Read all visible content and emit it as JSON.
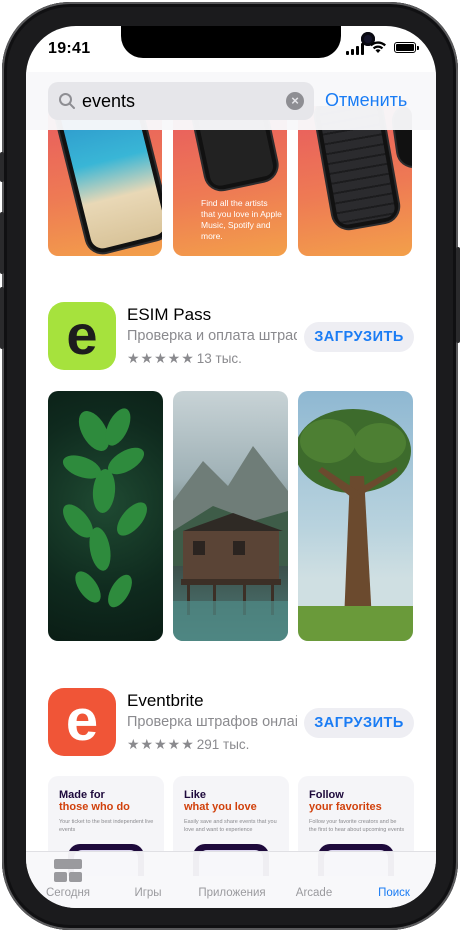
{
  "status": {
    "time": "19:41"
  },
  "search": {
    "query": "events",
    "cancel_label": "Отменить"
  },
  "top_screens": [
    {
      "caption": ""
    },
    {
      "caption": "Find all the artists that you love in Apple Music, Spotify and more."
    },
    {
      "caption": ""
    }
  ],
  "apps": [
    {
      "name": "ESIM Pass",
      "subtitle": "Проверка и оплата штрафов",
      "stars": "★★★★★",
      "rating_count": "13 тыс.",
      "get_label": "ЗАГРУЗИТЬ",
      "icon_letter": "e",
      "icon_color": "#a6e23d"
    },
    {
      "name": "Eventbrite",
      "subtitle": "Проверка штрафов онлайн",
      "stars": "★★★★★",
      "rating_count": "291 тыс.",
      "get_label": "ЗАГРУЗИТЬ",
      "icon_letter": "e",
      "icon_color": "#f05537"
    }
  ],
  "eventbrite_cards": [
    {
      "title": "Made for",
      "highlight": "those who do",
      "text": "Your ticket to the best independent live events"
    },
    {
      "title": "Like",
      "highlight": "what you love",
      "text": "Easily save and share events that you love and want to experience"
    },
    {
      "title": "Follow",
      "highlight": "your favorites",
      "text": "Follow your favorite creators and be the first to hear about upcoming events"
    }
  ],
  "tabbar": {
    "items": [
      {
        "label": "Сегодня",
        "icon": "today-icon",
        "active": false
      },
      {
        "label": "Игры",
        "icon": "games-icon",
        "active": false
      },
      {
        "label": "Приложения",
        "icon": "apps-icon",
        "active": false
      },
      {
        "label": "Arcade",
        "icon": "arcade-icon",
        "active": false
      },
      {
        "label": "Поиск",
        "icon": "search-icon",
        "active": true
      }
    ]
  },
  "colors": {
    "accent": "#1a7cf4",
    "screenshot_gradient": "#e85b5f",
    "eventbrite_orange": "#d1410c"
  }
}
